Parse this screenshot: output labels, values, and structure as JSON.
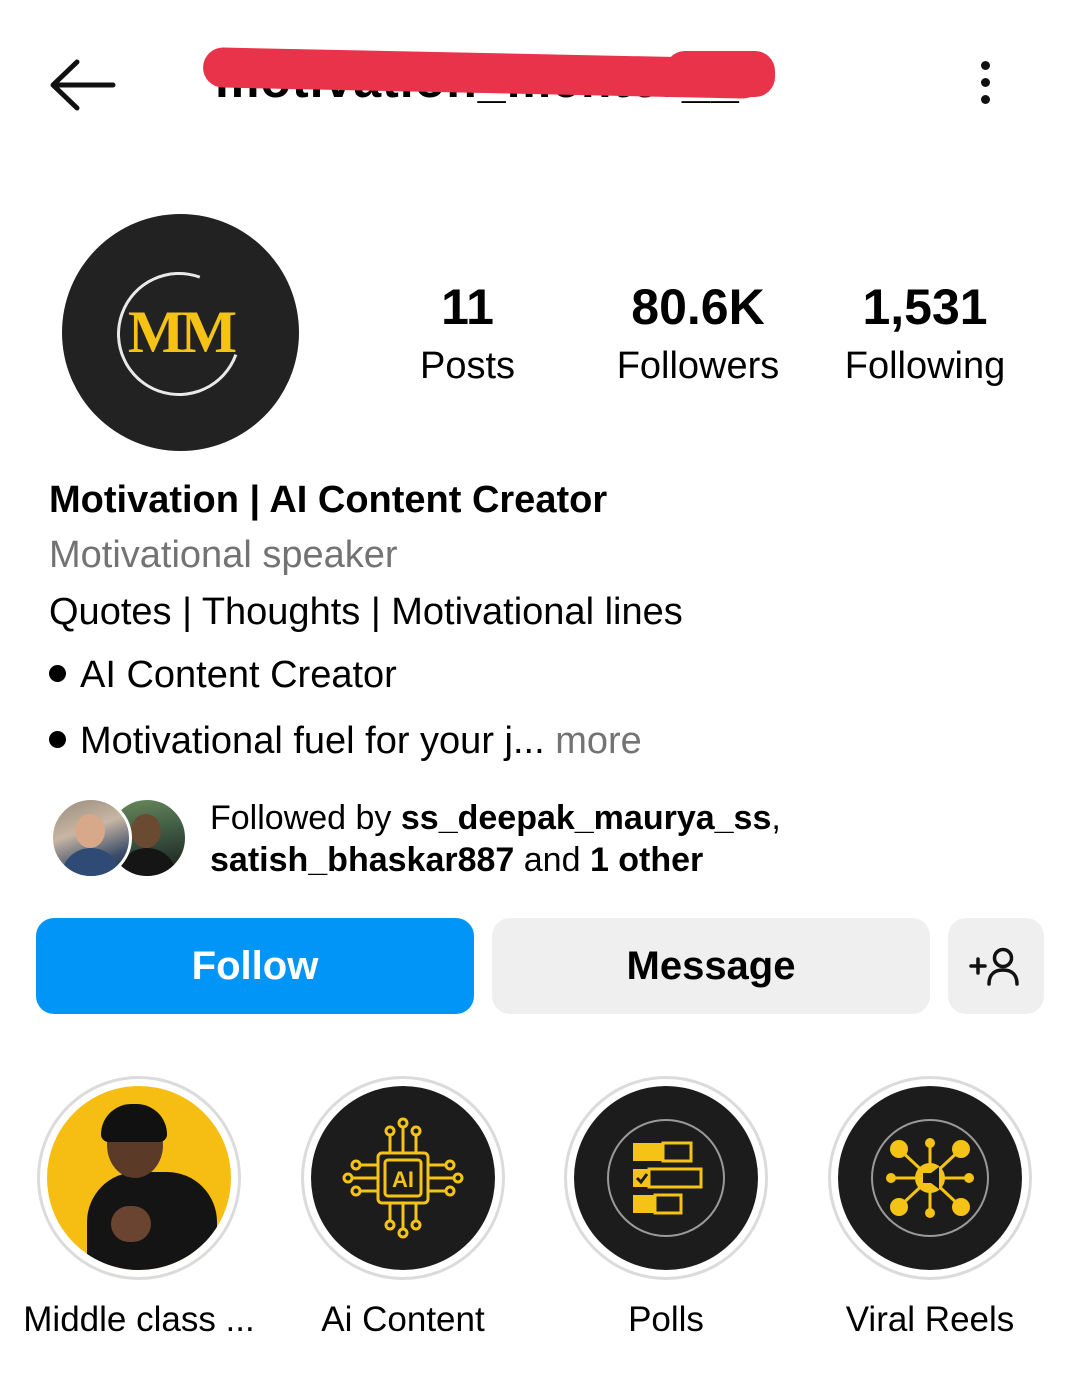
{
  "header": {
    "username": "motivation_mentor__",
    "username_redacted": true,
    "back_icon": "arrow-left-icon",
    "menu_icon": "kebab-menu-icon"
  },
  "profile": {
    "avatar_text": "MM",
    "avatar_colors": {
      "background": "#222222",
      "letters": "#f4c315"
    },
    "stats": {
      "posts": {
        "value": "11",
        "label": "Posts"
      },
      "followers": {
        "value": "80.6K",
        "label": "Followers"
      },
      "following": {
        "value": "1,531",
        "label": "Following"
      }
    },
    "display_name": "Motivation | AI Content Creator",
    "category": "Motivational speaker",
    "bio": {
      "line1": "Quotes | Thoughts | Motivational lines",
      "line2": "AI Content Creator",
      "line3": "Motivational fuel for your j...",
      "more_label": "more"
    },
    "followed_by": {
      "prefix": "Followed by ",
      "user1": "ss_deepak_maurya_ss",
      "separator": ",",
      "user2": "satish_bhaskar887",
      "middle": " and ",
      "others": "1 other"
    }
  },
  "actions": {
    "follow_label": "Follow",
    "message_label": "Message",
    "suggest_icon": "add-person-icon",
    "follow_color": "#0095f6"
  },
  "highlights": [
    {
      "label": "Middle class ...",
      "icon": "person-photo"
    },
    {
      "label": "Ai Content",
      "icon": "ai-chip-icon"
    },
    {
      "label": "Polls",
      "icon": "poll-icon"
    },
    {
      "label": "Viral Reels",
      "icon": "network-megaphone-icon"
    }
  ],
  "accent_colors": {
    "highlight_gold": "#f4c315",
    "redaction": "#e8334a"
  }
}
